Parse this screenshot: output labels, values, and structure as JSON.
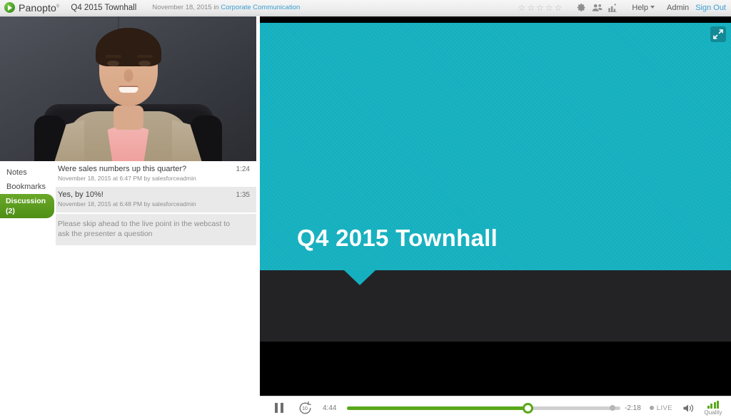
{
  "header": {
    "brand": "Panopto",
    "brand_tm": "®",
    "session_title": "Q4 2015 Townhall",
    "session_date": "November 18, 2015 in ",
    "folder_name": "Corporate Communication",
    "star_glyph": "☆",
    "star_count": 5,
    "rating_icon": "star-rating",
    "settings_icon": "gear-icon",
    "viewers_icon": "people-icon",
    "stats_icon": "stats-icon",
    "help_label": "Help",
    "admin_label": "Admin",
    "signout_label": "Sign Out"
  },
  "sidebar": {
    "tabs": [
      {
        "label": "Notes",
        "active": false
      },
      {
        "label": "Bookmarks",
        "active": false
      },
      {
        "label": "Discussion (2)",
        "active": true
      }
    ],
    "discussion": [
      {
        "text": "Were sales numbers up this quarter?",
        "time": "1:24",
        "meta": "November 18, 2015 at 6:47 PM by salesforceadmin",
        "shaded": false
      },
      {
        "text": "Yes, by 10%!",
        "time": "1:35",
        "meta": "November 18, 2015 at 6:48 PM by salesforceadmin",
        "shaded": true
      }
    ],
    "notice": "Please skip ahead to the live point in the webcast to ask the presenter a question"
  },
  "stage": {
    "slide_title": "Q4 2015 Townhall",
    "slide_bg_color": "#15b0bf",
    "slide_footer_color": "#232326",
    "expand_icon": "fullscreen-expand-icon"
  },
  "controls": {
    "pause_icon": "pause-icon",
    "rewind_icon": "rewind-10-icon",
    "rewind_seconds": "10",
    "time_elapsed": "4:44",
    "time_remaining": "-2:18",
    "live_label": "LIVE",
    "volume_icon": "volume-icon",
    "quality_label": "Quality",
    "quality_icon": "signal-bars-icon",
    "progress_percent": 66,
    "buffer_percent": 97,
    "accent_color": "#5aa81b"
  }
}
